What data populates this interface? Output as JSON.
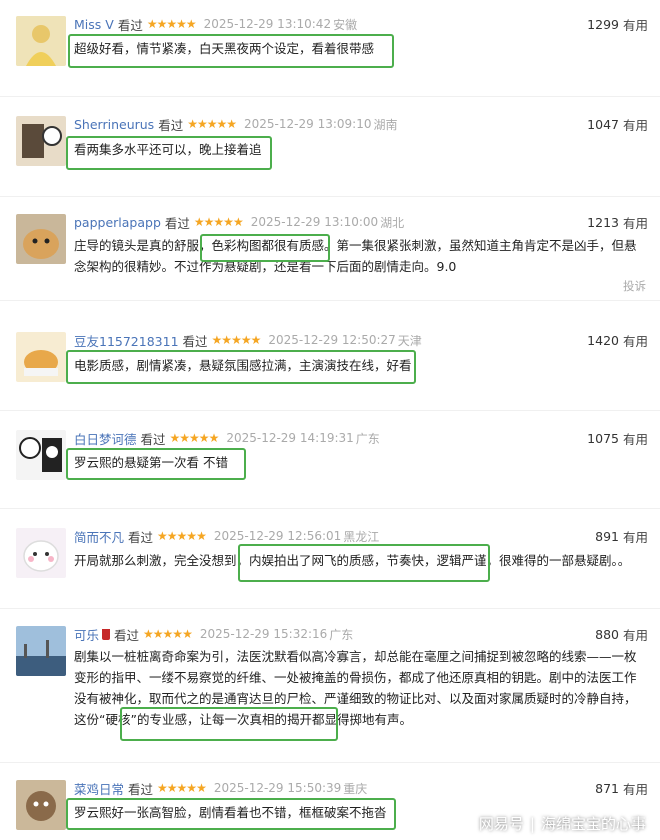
{
  "seen_label": "看过",
  "useful_label": "有用",
  "stars": "★★★★★",
  "report_label": "投诉",
  "reviews": [
    {
      "user": "Miss V",
      "time": "2025-12-29 13:10:42",
      "location": "安徽",
      "votes": "1299",
      "text": "超级好看，情节紧凑，白天黑夜两个设定，看着很带感"
    },
    {
      "user": "Sherrineurus",
      "time": "2025-12-29 13:09:10",
      "location": "湖南",
      "votes": "1047",
      "text": "看两集多水平还可以，晚上接着追"
    },
    {
      "user": "papperlapapp",
      "time": "2025-12-29 13:10:00",
      "location": "湖北",
      "votes": "1213",
      "text": "庄导的镜头是真的舒服，色彩构图都很有质感。第一集很紧张刺激，虽然知道主角肯定不是凶手，但悬念架构的很精妙。不过作为悬疑剧，还是看一下后面的剧情走向。9.0"
    },
    {
      "user": "豆友1157218311",
      "time": "2025-12-29 12:50:27",
      "location": "天津",
      "votes": "1420",
      "text": "电影质感，剧情紧凑，悬疑氛围感拉满，主演演技在线，好看"
    },
    {
      "user": "白日梦诃德",
      "time": "2025-12-29 14:19:31",
      "location": "广东",
      "votes": "1075",
      "text": "罗云熙的悬疑第一次看 不错"
    },
    {
      "user": "简而不凡",
      "time": "2025-12-29 12:56:01",
      "location": "黑龙江",
      "votes": "891",
      "text": "开局就那么刺激，完全没想到，内娱拍出了网飞的质感，节奏快，逻辑严谨，很难得的一部悬疑剧。。"
    },
    {
      "user": "可乐",
      "time": "2025-12-29 15:32:16",
      "location": "广东",
      "votes": "880",
      "text": "剧集以一桩桩离奇命案为引，法医沈默看似高冷寡言，却总能在毫厘之间捕捉到被忽略的线索——一枚变形的指甲、一缕不易察觉的纤维、一处被掩盖的骨损伤，都成了他还原真相的钥匙。剧中的法医工作没有被神化，取而代之的是通宵达旦的尸检、严谨细致的物证比对、以及面对家属质疑时的冷静自持，这份“硬核”的专业感，让每一次真相的揭开都显得掷地有声。"
    },
    {
      "user": "菜鸡日常",
      "time": "2025-12-29 15:50:39",
      "location": "重庆",
      "votes": "871",
      "text": "罗云熙好一张高智脸，剧情看着也不错，框框破案不拖沓"
    }
  ],
  "watermark": {
    "brand": "网易号",
    "account": "海绵宝宝的心事"
  },
  "colors": {
    "username": "#4a74b8",
    "stars": "#f5a623",
    "highlight_box": "#4cae4c",
    "muted": "#aaaaaa"
  }
}
